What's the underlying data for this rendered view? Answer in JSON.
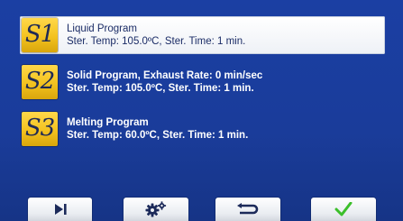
{
  "programs": [
    {
      "slot": "S1",
      "title": "Liquid Program",
      "detail": "Ster. Temp: 105.0ºC, Ster. Time: 1 min.",
      "selected": true
    },
    {
      "slot": "S2",
      "title": "Solid Program, Exhaust Rate: 0 min/sec",
      "detail": "Ster. Temp: 105.0ºC, Ster. Time: 1 min.",
      "selected": false
    },
    {
      "slot": "S3",
      "title": "Melting Program",
      "detail": "Ster. Temp: 60.0ºC, Ster. Time: 1 min.",
      "selected": false
    }
  ],
  "toolbar": {
    "buttons": [
      {
        "icon": "skip-next-icon"
      },
      {
        "icon": "gears-icon"
      },
      {
        "icon": "return-icon"
      },
      {
        "icon": "checkmark-icon",
        "color": "#3bbf2a"
      }
    ]
  },
  "colors": {
    "background": "#1b3fa3",
    "badge": "#f3c21f",
    "selected_text": "#1b2c66",
    "unselected_text": "#ffffff"
  }
}
